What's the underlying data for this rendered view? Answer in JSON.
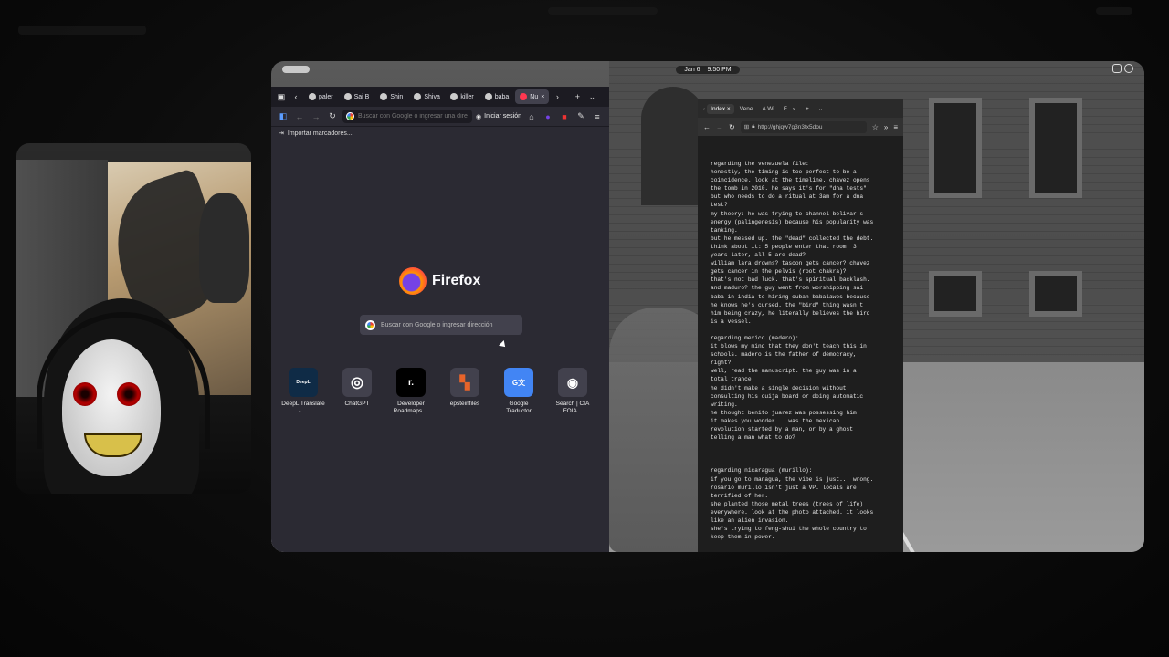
{
  "topbar": {
    "date": "Jan 6",
    "time": "9:50 PM"
  },
  "firefox": {
    "tabs": [
      {
        "label": "paler",
        "active": false
      },
      {
        "label": "Sai B",
        "active": false
      },
      {
        "label": "Shin",
        "active": false
      },
      {
        "label": "Shiva",
        "active": false
      },
      {
        "label": "killer",
        "active": false
      },
      {
        "label": "baba",
        "active": false
      },
      {
        "label": "Nu",
        "active": true
      }
    ],
    "url_placeholder": "Buscar con Google o ingresar una dire",
    "signin_label": "Iniciar sesión",
    "bookmarks_label": "Importar marcadores...",
    "logo_name": "Firefox",
    "search_placeholder": "Buscar con Google o ingresar dirección",
    "shortcuts": [
      {
        "label": "DeepL Translate - ...",
        "tile": "DeepL",
        "color": "#0f2b46"
      },
      {
        "label": "ChatGPT",
        "tile": "◎",
        "color": "#3a3a44"
      },
      {
        "label": "Developer Roadmaps ...",
        "tile": "r.",
        "color": "#000000"
      },
      {
        "label": "epsteinfiles",
        "tile": "▚",
        "color": "#e8642a"
      },
      {
        "label": "Google Traductor",
        "tile": "G文",
        "color": "#4285f4"
      },
      {
        "label": "Search | CIA FOIA...",
        "tile": "◉",
        "color": "#3a3a44"
      }
    ]
  },
  "textwin": {
    "tabs": [
      {
        "label": "Index",
        "active": true
      },
      {
        "label": "Vene",
        "active": false
      },
      {
        "label": "A Wi",
        "active": false
      },
      {
        "label": "F",
        "active": false
      }
    ],
    "url": "http://ghjqw7g3n3tx5dou",
    "body": "regarding the venezuela file:\nhonestly, the timing is too perfect to be a\ncoincidence. look at the timeline. chavez opens\nthe tomb in 2010. he says it's for \"dna tests\"\nbut who needs to do a ritual at 3am for a dna\ntest?\nmy theory: he was trying to channel bolivar's\nenergy (palingenesis) because his popularity was\ntanking.\nbut he messed up. the \"dead\" collected the debt.\nthink about it: 5 people enter that room. 3\nyears later, all 5 are dead?\nwilliam lara drowns? tascon gets cancer? chavez\ngets cancer in the pelvis (root chakra)?\nthat's not bad luck. that's spiritual backlash.\nand maduro? the guy went from worshipping sai\nbaba in india to hiring cuban babalawos because\nhe knows he's cursed. the \"bird\" thing wasn't\nhim being crazy, he literally believes the bird\nis a vessel.\n\nregarding mexico (madero):\nit blows my mind that they don't teach this in\nschools. madero is the father of democracy,\nright?\nwell, read the manuscript. the guy was in a\ntotal trance.\nhe didn't make a single decision without\nconsulting his ouija board or doing automatic\nwriting.\nhe thought benito juarez was possessing him.\nit makes you wonder... was the mexican\nrevolution started by a man, or by a ghost\ntelling a man what to do?\n\n\n\nregarding nicaragua (murillo):\nif you go to managua, the vibe is just... wrong.\nrosario murillo isn't just a VP. locals are\nterrified of her.\nshe planted those metal trees (trees of life)\neverywhere. look at the photo attached. it looks\nlike an alien invasion.\nshe's trying to feng-shui the whole country to\nkeep them in power."
  }
}
